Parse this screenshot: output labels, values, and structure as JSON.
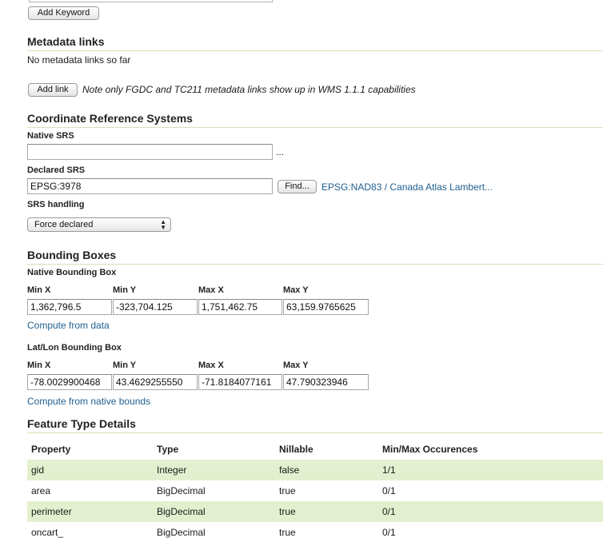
{
  "keywords": {
    "add_button": "Add Keyword"
  },
  "metadata_links": {
    "title": "Metadata links",
    "empty_text": "No metadata links so far",
    "add_button": "Add link",
    "note": "Note only FGDC and TC211 metadata links show up in WMS 1.1.1 capabilities"
  },
  "crs": {
    "title": "Coordinate Reference Systems",
    "native_label": "Native SRS",
    "native_value": "",
    "native_ellipsis": "...",
    "declared_label": "Declared SRS",
    "declared_value": "EPSG:3978",
    "find_button": "Find...",
    "declared_link": "EPSG:NAD83 / Canada Atlas Lambert...",
    "handling_label": "SRS handling",
    "handling_selected": "Force declared"
  },
  "bbox": {
    "title": "Bounding Boxes",
    "native": {
      "label": "Native Bounding Box",
      "headers": [
        "Min X",
        "Min Y",
        "Max X",
        "Max Y"
      ],
      "values": [
        "1,362,796.5",
        "-323,704.125",
        "1,751,462.75",
        "63,159.9765625"
      ],
      "compute_link": "Compute from data"
    },
    "latlon": {
      "label": "Lat/Lon Bounding Box",
      "headers": [
        "Min X",
        "Min Y",
        "Max X",
        "Max Y"
      ],
      "values": [
        "-78.0029900468",
        "43.4629255550",
        "-71.8184077161",
        "47.790323946"
      ],
      "compute_link": "Compute from native bounds"
    }
  },
  "feature_type": {
    "title": "Feature Type Details",
    "headers": [
      "Property",
      "Type",
      "Nillable",
      "Min/Max Occurences"
    ],
    "rows": [
      [
        "gid",
        "Integer",
        "false",
        "1/1"
      ],
      [
        "area",
        "BigDecimal",
        "true",
        "0/1"
      ],
      [
        "perimeter",
        "BigDecimal",
        "true",
        "0/1"
      ],
      [
        "oncart_",
        "BigDecimal",
        "true",
        "0/1"
      ]
    ]
  }
}
